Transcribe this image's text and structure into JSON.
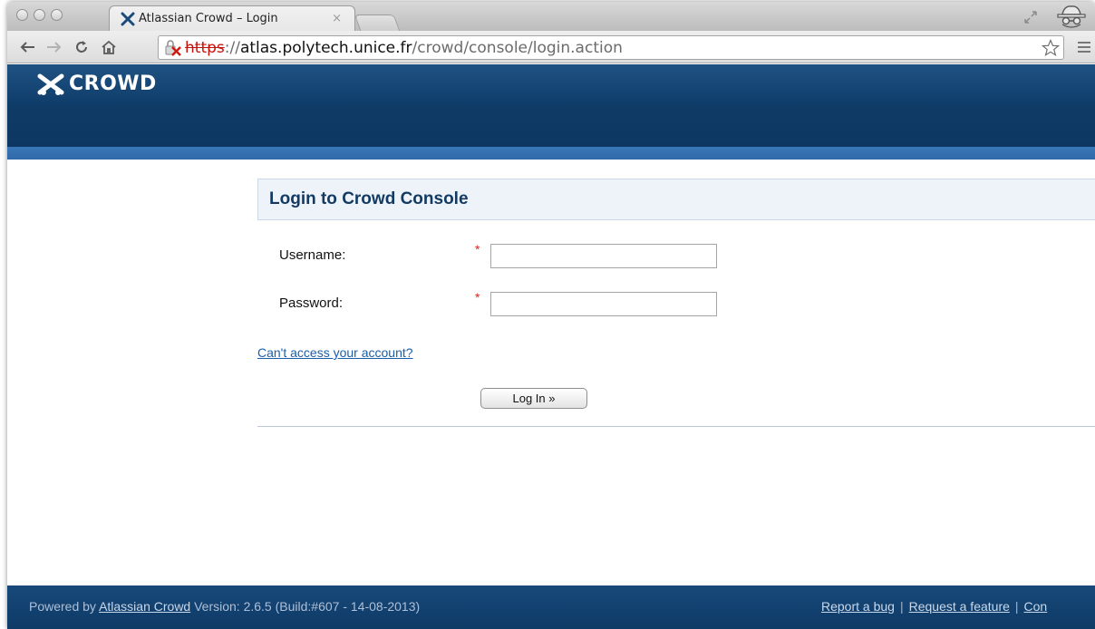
{
  "browser": {
    "tab_title": "Atlassian Crowd – Login",
    "tab_close": "×",
    "url": {
      "scheme": "https",
      "separator": "://",
      "host": "atlas.polytech.unice.fr",
      "path": "/crowd/console/login.action"
    }
  },
  "header": {
    "logo_text": "CROWD"
  },
  "login": {
    "title": "Login to Crowd Console",
    "username_label": "Username:",
    "password_label": "Password:",
    "required_mark": "*",
    "username_value": "",
    "password_value": "",
    "forgot_link": "Can't access your account?",
    "submit_label": "Log In »"
  },
  "footer": {
    "powered_by": "Powered by",
    "product_link": "Atlassian Crowd",
    "version": "Version: 2.6.5 (Build:#607 - 14-08-2013)",
    "links": [
      "Report a bug",
      "Request a feature",
      "Con"
    ],
    "separator": "|"
  },
  "colors": {
    "header_bg": "#15477a",
    "accent_stripe": "#3b75b3",
    "footer_bg": "#14436f",
    "link": "#1a5fa8",
    "required": "#e02020",
    "url_scheme_error": "#c3140e"
  }
}
